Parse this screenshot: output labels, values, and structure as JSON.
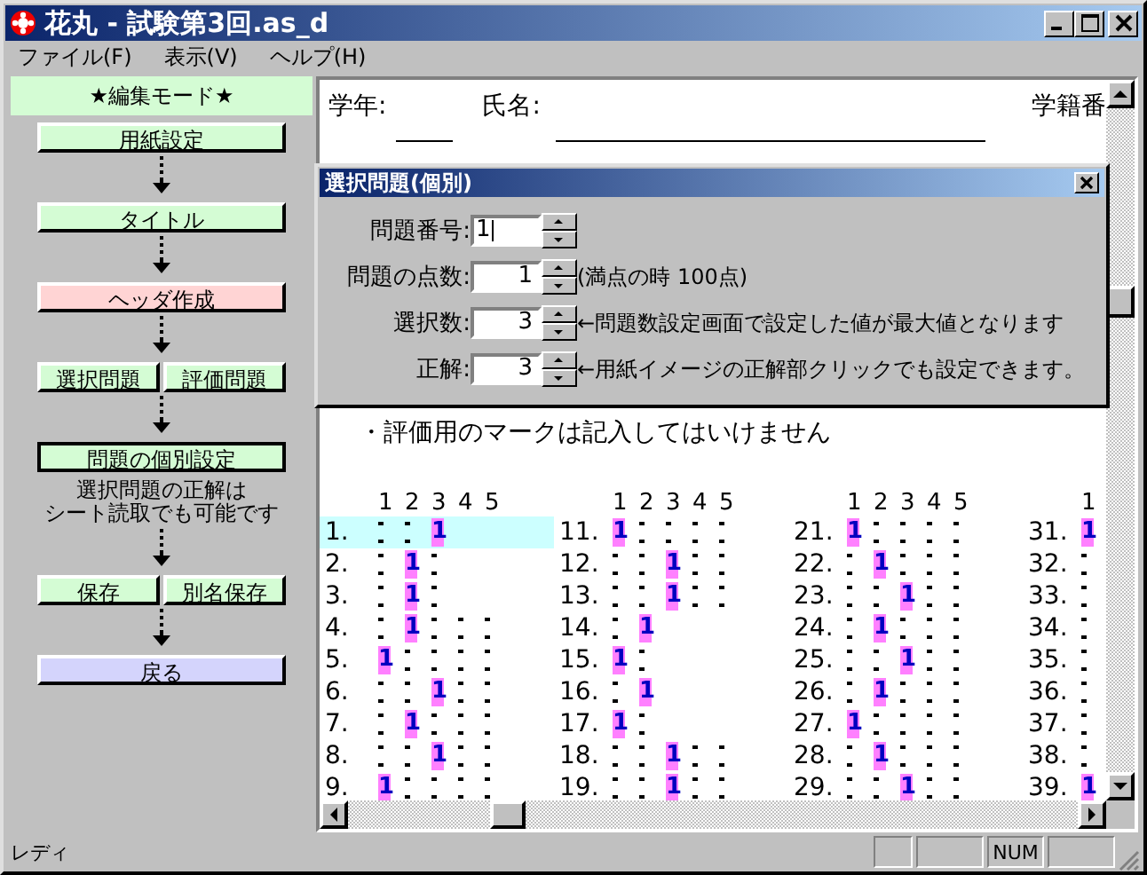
{
  "window": {
    "title": "花丸 - 試験第3回.as_d"
  },
  "menu": [
    "ファイル(F)",
    "表示(V)",
    "ヘルプ(H)"
  ],
  "sidebar": {
    "mode_label": "★編集モード★",
    "steps": [
      {
        "kind": "buttons",
        "arrow": true,
        "buttons": [
          {
            "label": "用紙設定",
            "color": "#d4fcd4",
            "selected": false
          }
        ]
      },
      {
        "kind": "buttons",
        "arrow": true,
        "buttons": [
          {
            "label": "タイトル",
            "color": "#d4fcd4",
            "selected": false
          }
        ]
      },
      {
        "kind": "buttons",
        "arrow": true,
        "buttons": [
          {
            "label": "ヘッダ作成",
            "color": "#ffd4d4",
            "selected": false
          }
        ]
      },
      {
        "kind": "buttons",
        "arrow": true,
        "buttons": [
          {
            "label": "選択問題",
            "color": "#d4fcd4",
            "selected": false
          },
          {
            "label": "評価問題",
            "color": "#d4fcd4",
            "selected": false
          }
        ]
      },
      {
        "kind": "buttons",
        "arrow": false,
        "buttons": [
          {
            "label": "問題の個別設定",
            "color": "#d4fcd4",
            "selected": true
          }
        ]
      },
      {
        "kind": "note",
        "arrow": true,
        "lines": [
          "選択問題の正解は",
          "シート読取でも可能です"
        ]
      },
      {
        "kind": "buttons",
        "arrow": true,
        "buttons": [
          {
            "label": "保存",
            "color": "#d4fcd4",
            "selected": false
          },
          {
            "label": "別名保存",
            "color": "#d4fcd4",
            "selected": false
          }
        ]
      },
      {
        "kind": "buttons",
        "arrow": false,
        "buttons": [
          {
            "label": "戻る",
            "color": "#d4d4fc",
            "selected": false
          }
        ]
      }
    ]
  },
  "sheet": {
    "grade_label": "学年:",
    "name_label": "氏名:",
    "id_label": "学籍番",
    "instruction": "・評価用のマークは記入してはいけません",
    "groups": [
      {
        "header": [
          "1",
          "2",
          "3",
          "4",
          "5"
        ],
        "rows": [
          {
            "number": "1.",
            "selected": true,
            "marks": [
              {
                "filled": false
              },
              {
                "filled": false
              },
              {
                "filled": true,
                "text": "1"
              }
            ]
          },
          {
            "number": "2.",
            "selected": false,
            "marks": [
              {
                "filled": false
              },
              {
                "filled": true,
                "text": "1"
              },
              {
                "filled": false
              }
            ]
          },
          {
            "number": "3.",
            "selected": false,
            "marks": [
              {
                "filled": false
              },
              {
                "filled": true,
                "text": "1"
              },
              {
                "filled": false
              }
            ]
          },
          {
            "number": "4.",
            "selected": false,
            "marks": [
              {
                "filled": false
              },
              {
                "filled": true,
                "text": "1"
              },
              {
                "filled": false
              },
              {
                "filled": false
              },
              {
                "filled": false
              }
            ]
          },
          {
            "number": "5.",
            "selected": false,
            "marks": [
              {
                "filled": true,
                "text": "1"
              },
              {
                "filled": false
              },
              {
                "filled": false
              },
              {
                "filled": false
              },
              {
                "filled": false
              }
            ]
          },
          {
            "number": "6.",
            "selected": false,
            "marks": [
              {
                "filled": false
              },
              {
                "filled": false
              },
              {
                "filled": true,
                "text": "1"
              },
              {
                "filled": false
              },
              {
                "filled": false
              }
            ]
          },
          {
            "number": "7.",
            "selected": false,
            "marks": [
              {
                "filled": false
              },
              {
                "filled": true,
                "text": "1"
              },
              {
                "filled": false
              },
              {
                "filled": false
              },
              {
                "filled": false
              }
            ]
          },
          {
            "number": "8.",
            "selected": false,
            "marks": [
              {
                "filled": false
              },
              {
                "filled": false
              },
              {
                "filled": true,
                "text": "1"
              },
              {
                "filled": false
              },
              {
                "filled": false
              }
            ]
          },
          {
            "number": "9.",
            "selected": false,
            "marks": [
              {
                "filled": true,
                "text": "1"
              },
              {
                "filled": false
              },
              {
                "filled": false
              },
              {
                "filled": false
              },
              {
                "filled": false
              }
            ]
          }
        ]
      },
      {
        "header": [
          "1",
          "2",
          "3",
          "4",
          "5"
        ],
        "rows": [
          {
            "number": "11.",
            "selected": false,
            "marks": [
              {
                "filled": true,
                "text": "1"
              },
              {
                "filled": false
              },
              {
                "filled": false
              },
              {
                "filled": false
              },
              {
                "filled": false
              }
            ]
          },
          {
            "number": "12.",
            "selected": false,
            "marks": [
              {
                "filled": false
              },
              {
                "filled": false
              },
              {
                "filled": true,
                "text": "1"
              },
              {
                "filled": false
              },
              {
                "filled": false
              }
            ]
          },
          {
            "number": "13.",
            "selected": false,
            "marks": [
              {
                "filled": false
              },
              {
                "filled": false
              },
              {
                "filled": true,
                "text": "1"
              },
              {
                "filled": false
              },
              {
                "filled": false
              }
            ]
          },
          {
            "number": "14.",
            "selected": false,
            "marks": [
              {
                "filled": false
              },
              {
                "filled": true,
                "text": "1"
              }
            ]
          },
          {
            "number": "15.",
            "selected": false,
            "marks": [
              {
                "filled": true,
                "text": "1"
              },
              {
                "filled": false
              }
            ]
          },
          {
            "number": "16.",
            "selected": false,
            "marks": [
              {
                "filled": false
              },
              {
                "filled": true,
                "text": "1"
              }
            ]
          },
          {
            "number": "17.",
            "selected": false,
            "marks": [
              {
                "filled": true,
                "text": "1"
              },
              {
                "filled": false
              }
            ]
          },
          {
            "number": "18.",
            "selected": false,
            "marks": [
              {
                "filled": false
              },
              {
                "filled": false
              },
              {
                "filled": true,
                "text": "1"
              },
              {
                "filled": false
              },
              {
                "filled": false
              }
            ]
          },
          {
            "number": "19.",
            "selected": false,
            "marks": [
              {
                "filled": false
              },
              {
                "filled": false
              },
              {
                "filled": true,
                "text": "1"
              },
              {
                "filled": false
              },
              {
                "filled": false
              }
            ]
          }
        ]
      },
      {
        "header": [
          "1",
          "2",
          "3",
          "4",
          "5"
        ],
        "rows": [
          {
            "number": "21.",
            "selected": false,
            "marks": [
              {
                "filled": true,
                "text": "1"
              },
              {
                "filled": false
              },
              {
                "filled": false
              },
              {
                "filled": false
              },
              {
                "filled": false
              }
            ]
          },
          {
            "number": "22.",
            "selected": false,
            "marks": [
              {
                "filled": false
              },
              {
                "filled": true,
                "text": "1"
              },
              {
                "filled": false
              },
              {
                "filled": false
              },
              {
                "filled": false
              }
            ]
          },
          {
            "number": "23.",
            "selected": false,
            "marks": [
              {
                "filled": false
              },
              {
                "filled": false
              },
              {
                "filled": true,
                "text": "1"
              },
              {
                "filled": false
              },
              {
                "filled": false
              }
            ]
          },
          {
            "number": "24.",
            "selected": false,
            "marks": [
              {
                "filled": false
              },
              {
                "filled": true,
                "text": "1"
              },
              {
                "filled": false
              },
              {
                "filled": false
              },
              {
                "filled": false
              }
            ]
          },
          {
            "number": "25.",
            "selected": false,
            "marks": [
              {
                "filled": false
              },
              {
                "filled": false
              },
              {
                "filled": true,
                "text": "1"
              },
              {
                "filled": false
              },
              {
                "filled": false
              }
            ]
          },
          {
            "number": "26.",
            "selected": false,
            "marks": [
              {
                "filled": false
              },
              {
                "filled": true,
                "text": "1"
              },
              {
                "filled": false
              },
              {
                "filled": false
              },
              {
                "filled": false
              }
            ]
          },
          {
            "number": "27.",
            "selected": false,
            "marks": [
              {
                "filled": true,
                "text": "1"
              },
              {
                "filled": false
              },
              {
                "filled": false
              },
              {
                "filled": false
              },
              {
                "filled": false
              }
            ]
          },
          {
            "number": "28.",
            "selected": false,
            "marks": [
              {
                "filled": false
              },
              {
                "filled": true,
                "text": "1"
              },
              {
                "filled": false
              },
              {
                "filled": false
              },
              {
                "filled": false
              }
            ]
          },
          {
            "number": "29.",
            "selected": false,
            "marks": [
              {
                "filled": false
              },
              {
                "filled": false
              },
              {
                "filled": true,
                "text": "1"
              },
              {
                "filled": false
              },
              {
                "filled": false
              }
            ]
          }
        ]
      },
      {
        "header": [
          "1"
        ],
        "rows": [
          {
            "number": "31.",
            "selected": false,
            "marks": [
              {
                "filled": true,
                "text": "1"
              }
            ]
          },
          {
            "number": "32.",
            "selected": false,
            "marks": [
              {
                "filled": false
              }
            ]
          },
          {
            "number": "33.",
            "selected": false,
            "marks": [
              {
                "filled": false
              }
            ]
          },
          {
            "number": "34.",
            "selected": false,
            "marks": [
              {
                "filled": false
              }
            ]
          },
          {
            "number": "35.",
            "selected": false,
            "marks": [
              {
                "filled": false
              }
            ]
          },
          {
            "number": "36.",
            "selected": false,
            "marks": [
              {
                "filled": false
              }
            ]
          },
          {
            "number": "37.",
            "selected": false,
            "marks": [
              {
                "filled": false
              }
            ]
          },
          {
            "number": "38.",
            "selected": false,
            "marks": [
              {
                "filled": false
              }
            ]
          },
          {
            "number": "39.",
            "selected": false,
            "marks": [
              {
                "filled": true,
                "text": "1"
              }
            ]
          }
        ]
      }
    ]
  },
  "dialog": {
    "title": "選択問題(個別)",
    "fields": [
      {
        "label": "問題番号:",
        "value": "1",
        "focused": true
      },
      {
        "label": "問題の点数:",
        "value": "1",
        "focused": false,
        "note": "(満点の時 100点)"
      },
      {
        "label": "選択数:",
        "value": "3",
        "focused": false,
        "note": "←問題数設定画面で設定した値が最大値となります"
      },
      {
        "label": "正解:",
        "value": "3",
        "focused": false,
        "note": "←用紙イメージの正解部クリックでも設定できます。"
      }
    ]
  },
  "status_bar": {
    "text": "レディ",
    "num_indicator": "NUM"
  }
}
